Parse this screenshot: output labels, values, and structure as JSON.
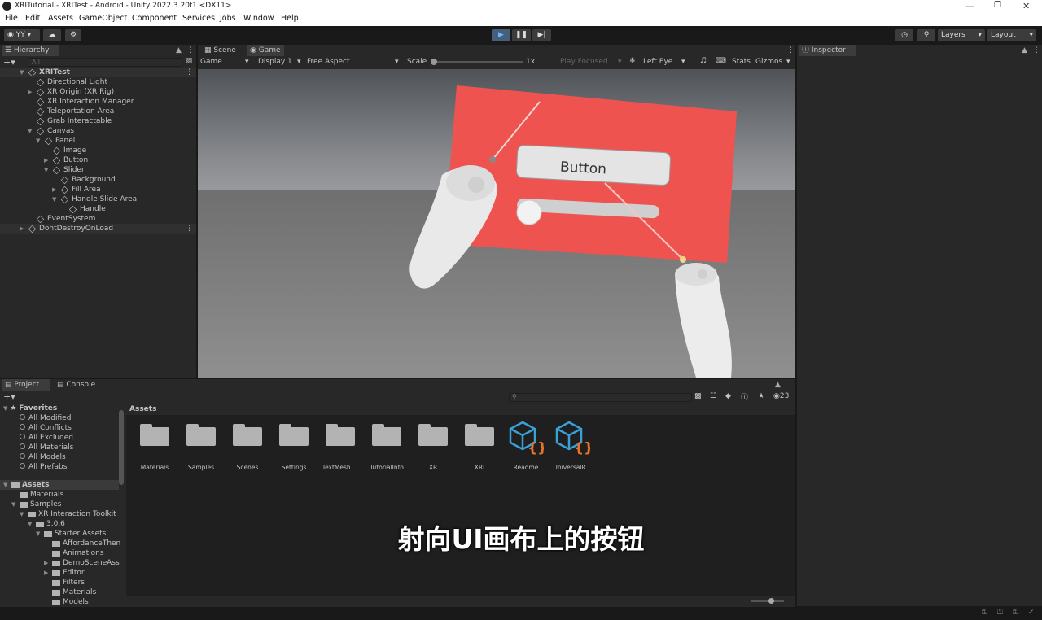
{
  "window": {
    "title": "XRITutorial - XRITest - Android - Unity 2022.3.20f1 <DX11>"
  },
  "menu": [
    "File",
    "Edit",
    "Assets",
    "GameObject",
    "Component",
    "Services",
    "Jobs",
    "Window",
    "Help"
  ],
  "toolbar": {
    "account": "YY",
    "layers": "Layers",
    "layout": "Layout"
  },
  "hierarchy": {
    "tab": "Hierarchy",
    "search_placeholder": "All",
    "items": [
      {
        "label": "XRITest",
        "depth": 0,
        "arrow": "open",
        "bold": true,
        "scene": true
      },
      {
        "label": "Directional Light",
        "depth": 1
      },
      {
        "label": "XR Origin (XR Rig)",
        "depth": 1,
        "arrow": "closed"
      },
      {
        "label": "XR Interaction Manager",
        "depth": 1
      },
      {
        "label": "Teleportation Area",
        "depth": 1
      },
      {
        "label": "Grab Interactable",
        "depth": 1
      },
      {
        "label": "Canvas",
        "depth": 1,
        "arrow": "open"
      },
      {
        "label": "Panel",
        "depth": 2,
        "arrow": "open"
      },
      {
        "label": "Image",
        "depth": 3
      },
      {
        "label": "Button",
        "depth": 3,
        "arrow": "closed"
      },
      {
        "label": "Slider",
        "depth": 3,
        "arrow": "open"
      },
      {
        "label": "Background",
        "depth": 4
      },
      {
        "label": "Fill Area",
        "depth": 4,
        "arrow": "closed"
      },
      {
        "label": "Handle Slide Area",
        "depth": 4,
        "arrow": "open"
      },
      {
        "label": "Handle",
        "depth": 5
      },
      {
        "label": "EventSystem",
        "depth": 1
      },
      {
        "label": "DontDestroyOnLoad",
        "depth": 0,
        "arrow": "closed",
        "scene": true
      }
    ]
  },
  "view": {
    "tab_scene": "Scene",
    "tab_game": "Game",
    "game_dropdown": "Game",
    "display": "Display 1",
    "aspect": "Free Aspect",
    "scale_label": "Scale",
    "scale_value": "1x",
    "play_focused": "Play Focused",
    "eye": "Left Eye",
    "stats": "Stats",
    "gizmos": "Gizmos"
  },
  "scene": {
    "button_text": "Button",
    "panel_color": "#ef5350",
    "slider_value": 0.0
  },
  "inspector": {
    "tab": "Inspector"
  },
  "project": {
    "tab_project": "Project",
    "tab_console": "Console",
    "count": "23",
    "breadcrumb": "Assets",
    "favorites_label": "Favorites",
    "favorites": [
      "All Modified",
      "All Conflicts",
      "All Excluded",
      "All Materials",
      "All Models",
      "All Prefabs"
    ],
    "tree": [
      {
        "label": "Assets",
        "depth": 0,
        "arrow": "open",
        "bold": true
      },
      {
        "label": "Materials",
        "depth": 1
      },
      {
        "label": "Samples",
        "depth": 1,
        "arrow": "open"
      },
      {
        "label": "XR Interaction Toolkit",
        "depth": 2,
        "arrow": "open"
      },
      {
        "label": "3.0.6",
        "depth": 3,
        "arrow": "open"
      },
      {
        "label": "Starter Assets",
        "depth": 4,
        "arrow": "open"
      },
      {
        "label": "AffordanceThen",
        "depth": 5
      },
      {
        "label": "Animations",
        "depth": 5
      },
      {
        "label": "DemoSceneAss",
        "depth": 5,
        "arrow": "closed"
      },
      {
        "label": "Editor",
        "depth": 5,
        "arrow": "closed"
      },
      {
        "label": "Filters",
        "depth": 5
      },
      {
        "label": "Materials",
        "depth": 5
      },
      {
        "label": "Models",
        "depth": 5
      }
    ],
    "assets": [
      {
        "label": "Materials",
        "kind": "folder"
      },
      {
        "label": "Samples",
        "kind": "folder"
      },
      {
        "label": "Scenes",
        "kind": "folder"
      },
      {
        "label": "Settings",
        "kind": "folder"
      },
      {
        "label": "TextMesh ...",
        "kind": "folder"
      },
      {
        "label": "TutorialInfo",
        "kind": "folder"
      },
      {
        "label": "XR",
        "kind": "folder"
      },
      {
        "label": "XRI",
        "kind": "folder"
      },
      {
        "label": "Readme",
        "kind": "script"
      },
      {
        "label": "UniversalR...",
        "kind": "script"
      }
    ]
  },
  "subtitle": "射向UI画布上的按钮"
}
